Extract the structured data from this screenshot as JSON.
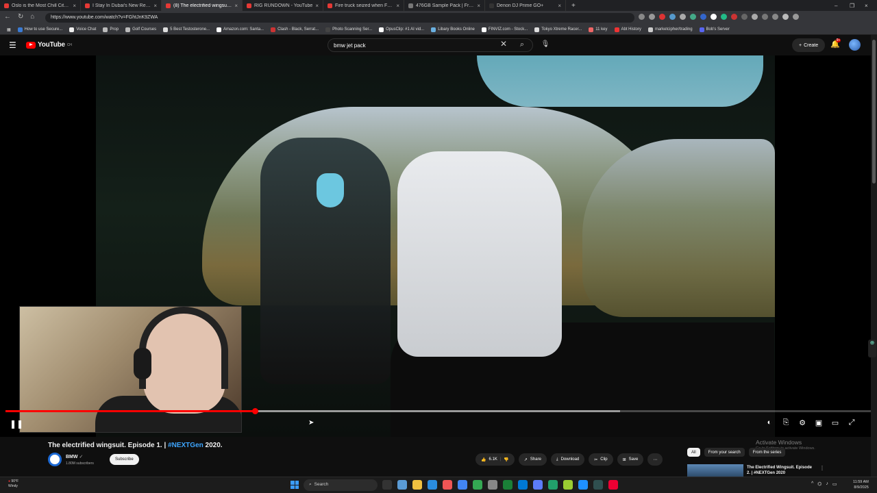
{
  "browser": {
    "tabs": [
      {
        "title": "Oslo is the Most Chill City on Earth",
        "color": "#e53935"
      },
      {
        "title": "I Stay In Dubai's New Record-Breaking",
        "color": "#e53935"
      },
      {
        "title": "(8) The electrified wingsuit. Episode",
        "color": "#e53935",
        "active": true
      },
      {
        "title": "RIG RUNDOWN - YouTube",
        "color": "#e53935"
      },
      {
        "title": "Fire truck seized when FBI raids h",
        "color": "#e53935"
      },
      {
        "title": "476GB Sample Pack | Free Downl",
        "color": "#777777"
      },
      {
        "title": "Denon DJ Prime GO+",
        "color": "#333333"
      }
    ],
    "url": "https://www.youtube.com/watch?v=FGhtJnK9ZWA",
    "bookmarks": [
      {
        "label": "How to use Secure..."
      },
      {
        "label": "Voice Chat"
      },
      {
        "label": "Prop"
      },
      {
        "label": "Golf Courses"
      },
      {
        "label": "5 Best Testosterone..."
      },
      {
        "label": "Amazon.com: Santa..."
      },
      {
        "label": "Clash - Black, Serrat..."
      },
      {
        "label": "Photo Scanning Ser..."
      },
      {
        "label": "OpusClip: #1 AI vid..."
      },
      {
        "label": "Libary Books Online"
      },
      {
        "label": "FINVIZ.com - Stock..."
      },
      {
        "label": "Tokyo Xtreme Racer..."
      },
      {
        "label": "11 key"
      },
      {
        "label": "Abt History"
      },
      {
        "label": "marketcipher/trading"
      },
      {
        "label": "Bob's Server"
      }
    ]
  },
  "youtube": {
    "logo_text": "YouTube",
    "logo_region": "CH",
    "search_value": "bmw jet pack",
    "create_label": "Create",
    "notification_count": "9+",
    "progress": {
      "buffered_fraction": 0.71,
      "played_fraction": 0.288
    },
    "video": {
      "title_prefix": "The electrified wingsuit. Episode 1. | ",
      "title_tag": "#NEXTGen",
      "title_suffix": " 2020.",
      "channel": "BMW",
      "subscribers": "1.80M subscribers",
      "subscribe_label": "Subscribe",
      "likes": "6.1K",
      "share_label": "Share",
      "download_label": "Download",
      "clip_label": "Clip",
      "save_label": "Save"
    },
    "chips": {
      "all": "All",
      "from_search": "From your search",
      "from_series": "From the series"
    },
    "recommendation": {
      "title": "The Electrified Wingsuit. Episode 2. | #NEXTGen 2020"
    },
    "watermark": {
      "line1": "Activate Windows",
      "line2": "Go to Settings to activate Windows."
    }
  },
  "taskbar": {
    "temperature": "90°F",
    "weather": "Windy",
    "search_label": "Search",
    "time": "11:59 AM",
    "date": "8/9/2025"
  }
}
